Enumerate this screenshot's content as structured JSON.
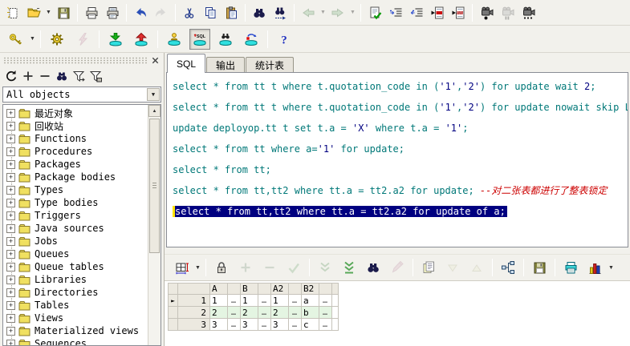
{
  "colors": {
    "code": "#007878",
    "string": "#000080",
    "comment": "#cc0000",
    "selection_bg": "#000080",
    "selection_caret": "#ffe400",
    "row_tint": "#e4f5e2",
    "disc_cyan": "#30e0e0",
    "toolbar_bg": "#f2f1ec"
  },
  "toolbar_main": {
    "items": [
      {
        "name": "new-document",
        "icon": "doc-new"
      },
      {
        "name": "open-file",
        "icon": "folder-open",
        "dropdown": true
      },
      {
        "name": "save",
        "icon": "floppy"
      },
      {
        "sep": true
      },
      {
        "name": "print",
        "icon": "printer"
      },
      {
        "name": "print-preview",
        "icon": "printer-preview"
      },
      {
        "sep": true
      },
      {
        "name": "undo",
        "icon": "undo"
      },
      {
        "name": "redo",
        "icon": "redo",
        "disabled": true
      },
      {
        "sep": true
      },
      {
        "name": "cut",
        "icon": "scissors"
      },
      {
        "name": "copy",
        "icon": "copy"
      },
      {
        "name": "paste",
        "icon": "paste"
      },
      {
        "sep": true
      },
      {
        "name": "find",
        "icon": "binoculars"
      },
      {
        "name": "find-next",
        "icon": "binoculars-next"
      },
      {
        "sep": true
      },
      {
        "name": "navigate-back",
        "icon": "arrow-left",
        "disabled": true,
        "dropdown": true,
        "dropdown_disabled": true
      },
      {
        "name": "navigate-forward",
        "icon": "arrow-right",
        "disabled": true,
        "dropdown": true,
        "dropdown_disabled": true
      },
      {
        "sep": true
      },
      {
        "name": "check-syntax",
        "icon": "doc-check"
      },
      {
        "name": "indent",
        "icon": "indent"
      },
      {
        "name": "outdent",
        "icon": "outdent"
      },
      {
        "name": "next-marker",
        "icon": "doc-redbar"
      },
      {
        "name": "previous-marker",
        "icon": "doc-redbar2"
      },
      {
        "sep": true
      },
      {
        "name": "record-macro",
        "icon": "camera-record"
      },
      {
        "name": "pause-macro",
        "icon": "camera-pause",
        "disabled": true
      },
      {
        "name": "playback-macro",
        "icon": "camera-dots"
      }
    ]
  },
  "toolbar_session": {
    "items": [
      {
        "name": "log-on",
        "icon": "key",
        "dropdown": true
      },
      {
        "sep": true
      },
      {
        "name": "configure",
        "icon": "gear"
      },
      {
        "name": "break",
        "icon": "lightning",
        "disabled": true
      },
      {
        "sep": true
      },
      {
        "name": "commit",
        "icon": "commit"
      },
      {
        "name": "rollback",
        "icon": "rollback"
      },
      {
        "sep": true
      },
      {
        "name": "new-session",
        "icon": "disc-user"
      },
      {
        "name": "new-sql-window",
        "icon": "disc-sql",
        "pressed": true
      },
      {
        "name": "browse-objects",
        "icon": "disc-find"
      },
      {
        "name": "refresh-session",
        "icon": "disc-refresh"
      },
      {
        "sep": true
      },
      {
        "name": "help",
        "icon": "help"
      }
    ]
  },
  "sidebar": {
    "close_label": "close-panel",
    "toolbar": [
      {
        "name": "refresh-tree",
        "icon": "refresh"
      },
      {
        "name": "expand-all",
        "icon": "plus"
      },
      {
        "name": "collapse-all",
        "icon": "minus"
      },
      {
        "name": "find-object",
        "icon": "binoculars-small"
      },
      {
        "name": "edit-filters",
        "icon": "filter-arrow"
      },
      {
        "name": "apply-filter",
        "icon": "filter-box"
      }
    ],
    "combo_value": "All objects",
    "tree_items": [
      {
        "label": "最近对象"
      },
      {
        "label": "回收站"
      },
      {
        "label": "Functions"
      },
      {
        "label": "Procedures"
      },
      {
        "label": "Packages"
      },
      {
        "label": "Package bodies"
      },
      {
        "label": "Types"
      },
      {
        "label": "Type bodies"
      },
      {
        "label": "Triggers"
      },
      {
        "label": "Java sources"
      },
      {
        "label": "Jobs"
      },
      {
        "label": "Queues"
      },
      {
        "label": "Queue tables"
      },
      {
        "label": "Libraries"
      },
      {
        "label": "Directories"
      },
      {
        "label": "Tables"
      },
      {
        "label": "Views"
      },
      {
        "label": "Materialized views"
      },
      {
        "label": "Sequences"
      }
    ]
  },
  "tabs": [
    {
      "label": "SQL",
      "active": true
    },
    {
      "label": "输出",
      "active": false
    },
    {
      "label": "统计表",
      "active": false
    }
  ],
  "editor": {
    "lines": [
      {
        "segments": [
          [
            "select * from tt t where t.quotation_code in (",
            "k"
          ],
          [
            "'1'",
            "s"
          ],
          [
            ",",
            "k"
          ],
          [
            "'2'",
            "s"
          ],
          [
            ") for update wait ",
            "k"
          ],
          [
            "2",
            "s"
          ],
          [
            ";",
            "k"
          ]
        ]
      },
      {
        "segments": [
          [
            "select * from tt t where t.quotation_code in (",
            "k"
          ],
          [
            "'1'",
            "s"
          ],
          [
            ",",
            "k"
          ],
          [
            "'2'",
            "s"
          ],
          [
            ") for update nowait skip Locked;",
            "k"
          ]
        ]
      },
      {
        "segments": [
          [
            "update deployop.tt t set t.a = ",
            "k"
          ],
          [
            "'X'",
            "s"
          ],
          [
            " where t.a = ",
            "k"
          ],
          [
            "'1'",
            "s"
          ],
          [
            ";",
            "k"
          ]
        ]
      },
      {
        "segments": [
          [
            "select * from tt where a=",
            "k"
          ],
          [
            "'1'",
            "s"
          ],
          [
            " for update;",
            "k"
          ]
        ]
      },
      {
        "segments": [
          [
            "select * from tt;",
            "k"
          ]
        ]
      },
      {
        "segments": [
          [
            "select * from tt,tt2 where tt.a = tt2.a2 for update; ",
            "k"
          ],
          [
            "--对二张表都进行了整表锁定",
            "c"
          ]
        ]
      },
      {
        "segments": [
          [
            "select * from tt,tt2 where tt.a = tt2.a2 for update of a;",
            "k"
          ]
        ],
        "selected": true
      }
    ]
  },
  "results": {
    "toolbar": [
      {
        "name": "grid-options",
        "icon": "grid",
        "dropdown": true
      },
      {
        "sep": true
      },
      {
        "name": "lock-columns",
        "icon": "padlock"
      },
      {
        "name": "insert-row",
        "icon": "plus-pale",
        "disabled": true
      },
      {
        "name": "delete-row",
        "icon": "minus-pale",
        "disabled": true
      },
      {
        "name": "post-changes",
        "icon": "check-pale",
        "disabled": true
      },
      {
        "sep": true
      },
      {
        "name": "fetch-next-page",
        "icon": "chevrons-down",
        "disabled": true
      },
      {
        "name": "fetch-last-page",
        "icon": "chevrons-down-line"
      },
      {
        "name": "find-in-results",
        "icon": "binoculars"
      },
      {
        "name": "edit-data",
        "icon": "pen-pink",
        "disabled": true
      },
      {
        "sep": true
      },
      {
        "name": "copy-results",
        "icon": "note-copy"
      },
      {
        "name": "sort-descending",
        "icon": "tri-down",
        "disabled": true
      },
      {
        "name": "sort-ascending",
        "icon": "tri-up",
        "disabled": true
      },
      {
        "sep": true
      },
      {
        "name": "single-record-view",
        "icon": "structure"
      },
      {
        "sep": true
      },
      {
        "name": "export-results",
        "icon": "floppy"
      },
      {
        "sep": true
      },
      {
        "name": "print-results",
        "icon": "printer-cyan"
      },
      {
        "name": "chart",
        "icon": "barchart",
        "dropdown": true
      }
    ],
    "grid": {
      "columns": [
        "A",
        "B",
        "A2",
        "B2"
      ],
      "ellipsis": "…",
      "current_marker": "►",
      "rows": [
        {
          "num": "1",
          "cells": [
            "1",
            "1",
            "1",
            "a"
          ],
          "current": true,
          "tint": false
        },
        {
          "num": "2",
          "cells": [
            "2",
            "2",
            "2",
            "b"
          ],
          "current": false,
          "tint": true
        },
        {
          "num": "3",
          "cells": [
            "3",
            "3",
            "3",
            "c"
          ],
          "current": false,
          "tint": false
        }
      ]
    }
  }
}
